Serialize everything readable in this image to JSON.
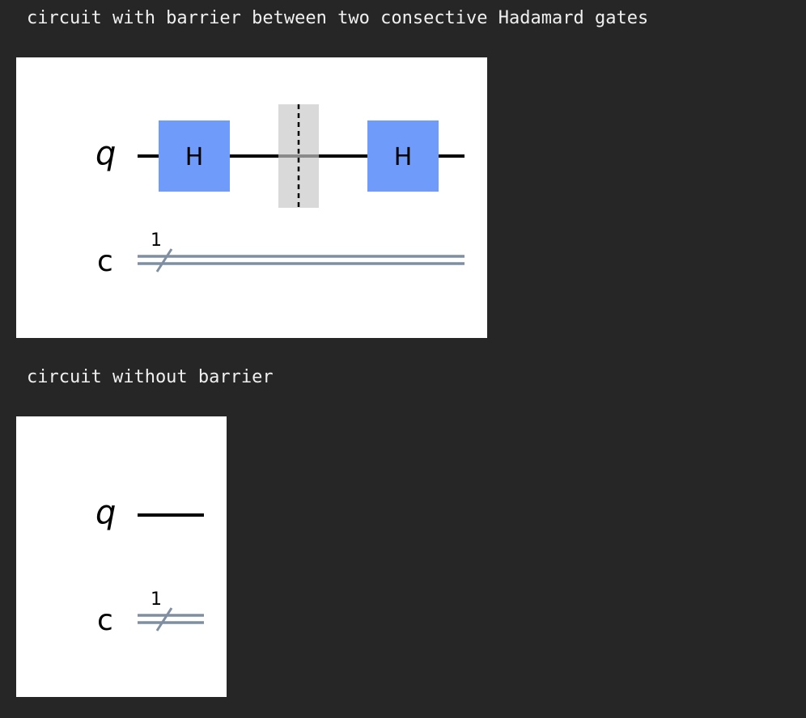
{
  "captions": {
    "with_barrier": "circuit with barrier between two consective Hadamard gates",
    "without_barrier": "circuit without barrier"
  },
  "circuit_with_barrier": {
    "quantum_register": "q",
    "classical_register": "c",
    "classical_bit_count": "1",
    "gates": [
      {
        "name": "H"
      },
      {
        "type": "barrier"
      },
      {
        "name": "H"
      }
    ]
  },
  "circuit_without_barrier": {
    "quantum_register": "q",
    "classical_register": "c",
    "classical_bit_count": "1",
    "gates": []
  },
  "colors": {
    "page_background": "#262626",
    "caption_text": "#f0f0f0",
    "figure_background": "#ffffff",
    "gate_fill": "#6f9bfb",
    "barrier_fill": "#d9d9d9",
    "classical_wire": "#7f8fa1",
    "quantum_wire": "#000000"
  }
}
